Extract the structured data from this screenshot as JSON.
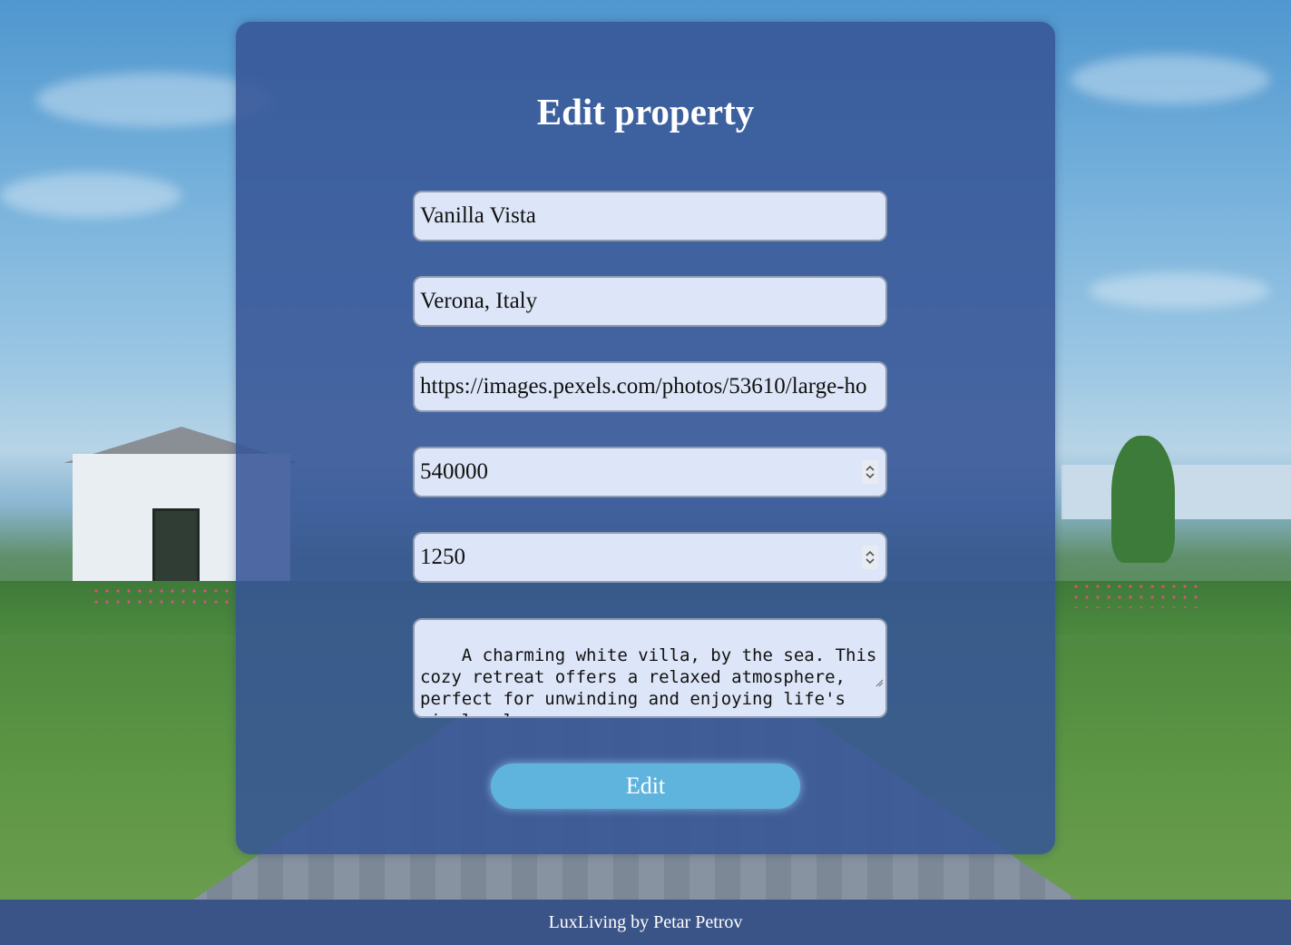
{
  "form": {
    "title": "Edit property",
    "fields": {
      "name": "Vanilla Vista",
      "location": "Verona, Italy",
      "image_url": "https://images.pexels.com/photos/53610/large-ho",
      "price": "540000",
      "area": "1250",
      "description": "A charming white villa, by the sea. This cozy retreat offers a relaxed atmosphere, perfect for unwinding and enjoying life's simple pleasures."
    },
    "submit_label": "Edit"
  },
  "footer": {
    "text": "LuxLiving by Petar Petrov"
  },
  "colors": {
    "card": "#37559a",
    "input_bg": "#dde6f8",
    "button": "#5fb4de",
    "footer": "#3b5488"
  }
}
